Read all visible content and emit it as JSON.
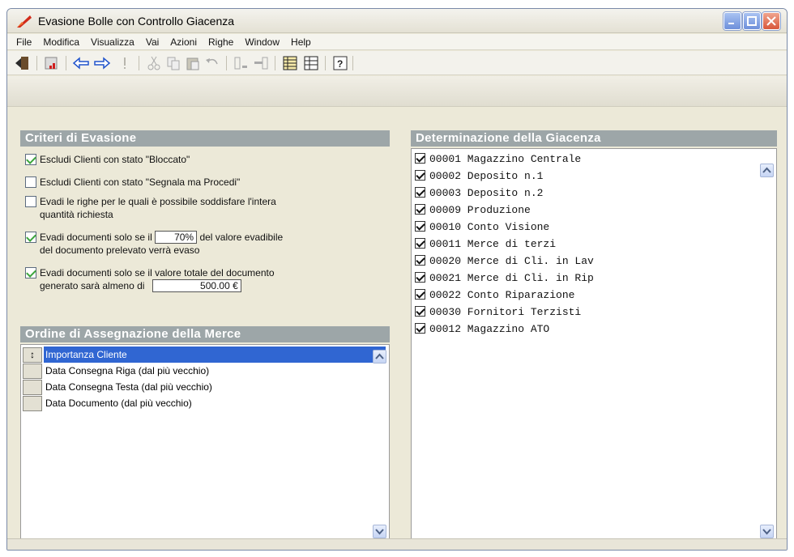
{
  "window": {
    "title": "Evasione Bolle con Controllo Giacenza"
  },
  "menu": [
    "File",
    "Modifica",
    "Visualizza",
    "Vai",
    "Azioni",
    "Righe",
    "Window",
    "Help"
  ],
  "criteri": {
    "title": "Criteri di Evasione",
    "items": [
      {
        "checked": true,
        "text": "Escludi Clienti con stato \"Bloccato\""
      },
      {
        "checked": false,
        "text": "Escludi Clienti con stato \"Segnala ma Procedi\""
      },
      {
        "checked": false,
        "text_line1": "Evadi le righe per le quali è possibile soddisfare l'intera",
        "text_line2": "quantità richiesta"
      },
      {
        "checked": true,
        "pre": "Evadi documenti solo se il",
        "value": "70%",
        "post": "del valore evadibile",
        "line2": "del documento prelevato verrà evaso"
      },
      {
        "checked": true,
        "line1": "Evadi documenti solo se il valore totale del documento",
        "pre": "generato sarà almeno di",
        "value": "500.00 €"
      }
    ]
  },
  "ordine": {
    "title": "Ordine di Assegnazione della Merce",
    "items": [
      {
        "label": "Importanza Cliente",
        "selected": true,
        "handle": "↕"
      },
      {
        "label": "Data Consegna Riga (dal più vecchio)",
        "selected": false
      },
      {
        "label": "Data Consegna Testa (dal più vecchio)",
        "selected": false
      },
      {
        "label": "Data Documento (dal più vecchio)",
        "selected": false
      }
    ]
  },
  "giacenza": {
    "title": "Determinazione della Giacenza",
    "items": [
      {
        "checked": true,
        "label": "00001 Magazzino Centrale"
      },
      {
        "checked": true,
        "label": "00002 Deposito n.1"
      },
      {
        "checked": true,
        "label": "00003 Deposito n.2"
      },
      {
        "checked": true,
        "label": "00009 Produzione"
      },
      {
        "checked": true,
        "label": "00010 Conto Visione"
      },
      {
        "checked": true,
        "label": "00011 Merce di terzi"
      },
      {
        "checked": true,
        "label": "00020 Merce di Cli. in Lav"
      },
      {
        "checked": true,
        "label": "00021 Merce di Cli. in Rip"
      },
      {
        "checked": true,
        "label": "00022 Conto Riparazione"
      },
      {
        "checked": true,
        "label": "00030 Fornitori Terzisti"
      },
      {
        "checked": true,
        "label": "00012 Magazzino ATO"
      }
    ]
  },
  "toolbar": {
    "icons": [
      "exit-icon",
      "chart-icon",
      "back-arrow-icon",
      "forward-arrow-icon",
      "exclamation-icon",
      "cut-icon",
      "copy-icon",
      "paste-icon",
      "undo-icon",
      "insert-row-icon",
      "delete-row-icon",
      "grid-detail-icon",
      "grid-icon",
      "help-icon"
    ]
  },
  "colors": {
    "panel_header": "#9da6a8",
    "selection": "#3066d2",
    "check_green": "#3ca53c"
  }
}
